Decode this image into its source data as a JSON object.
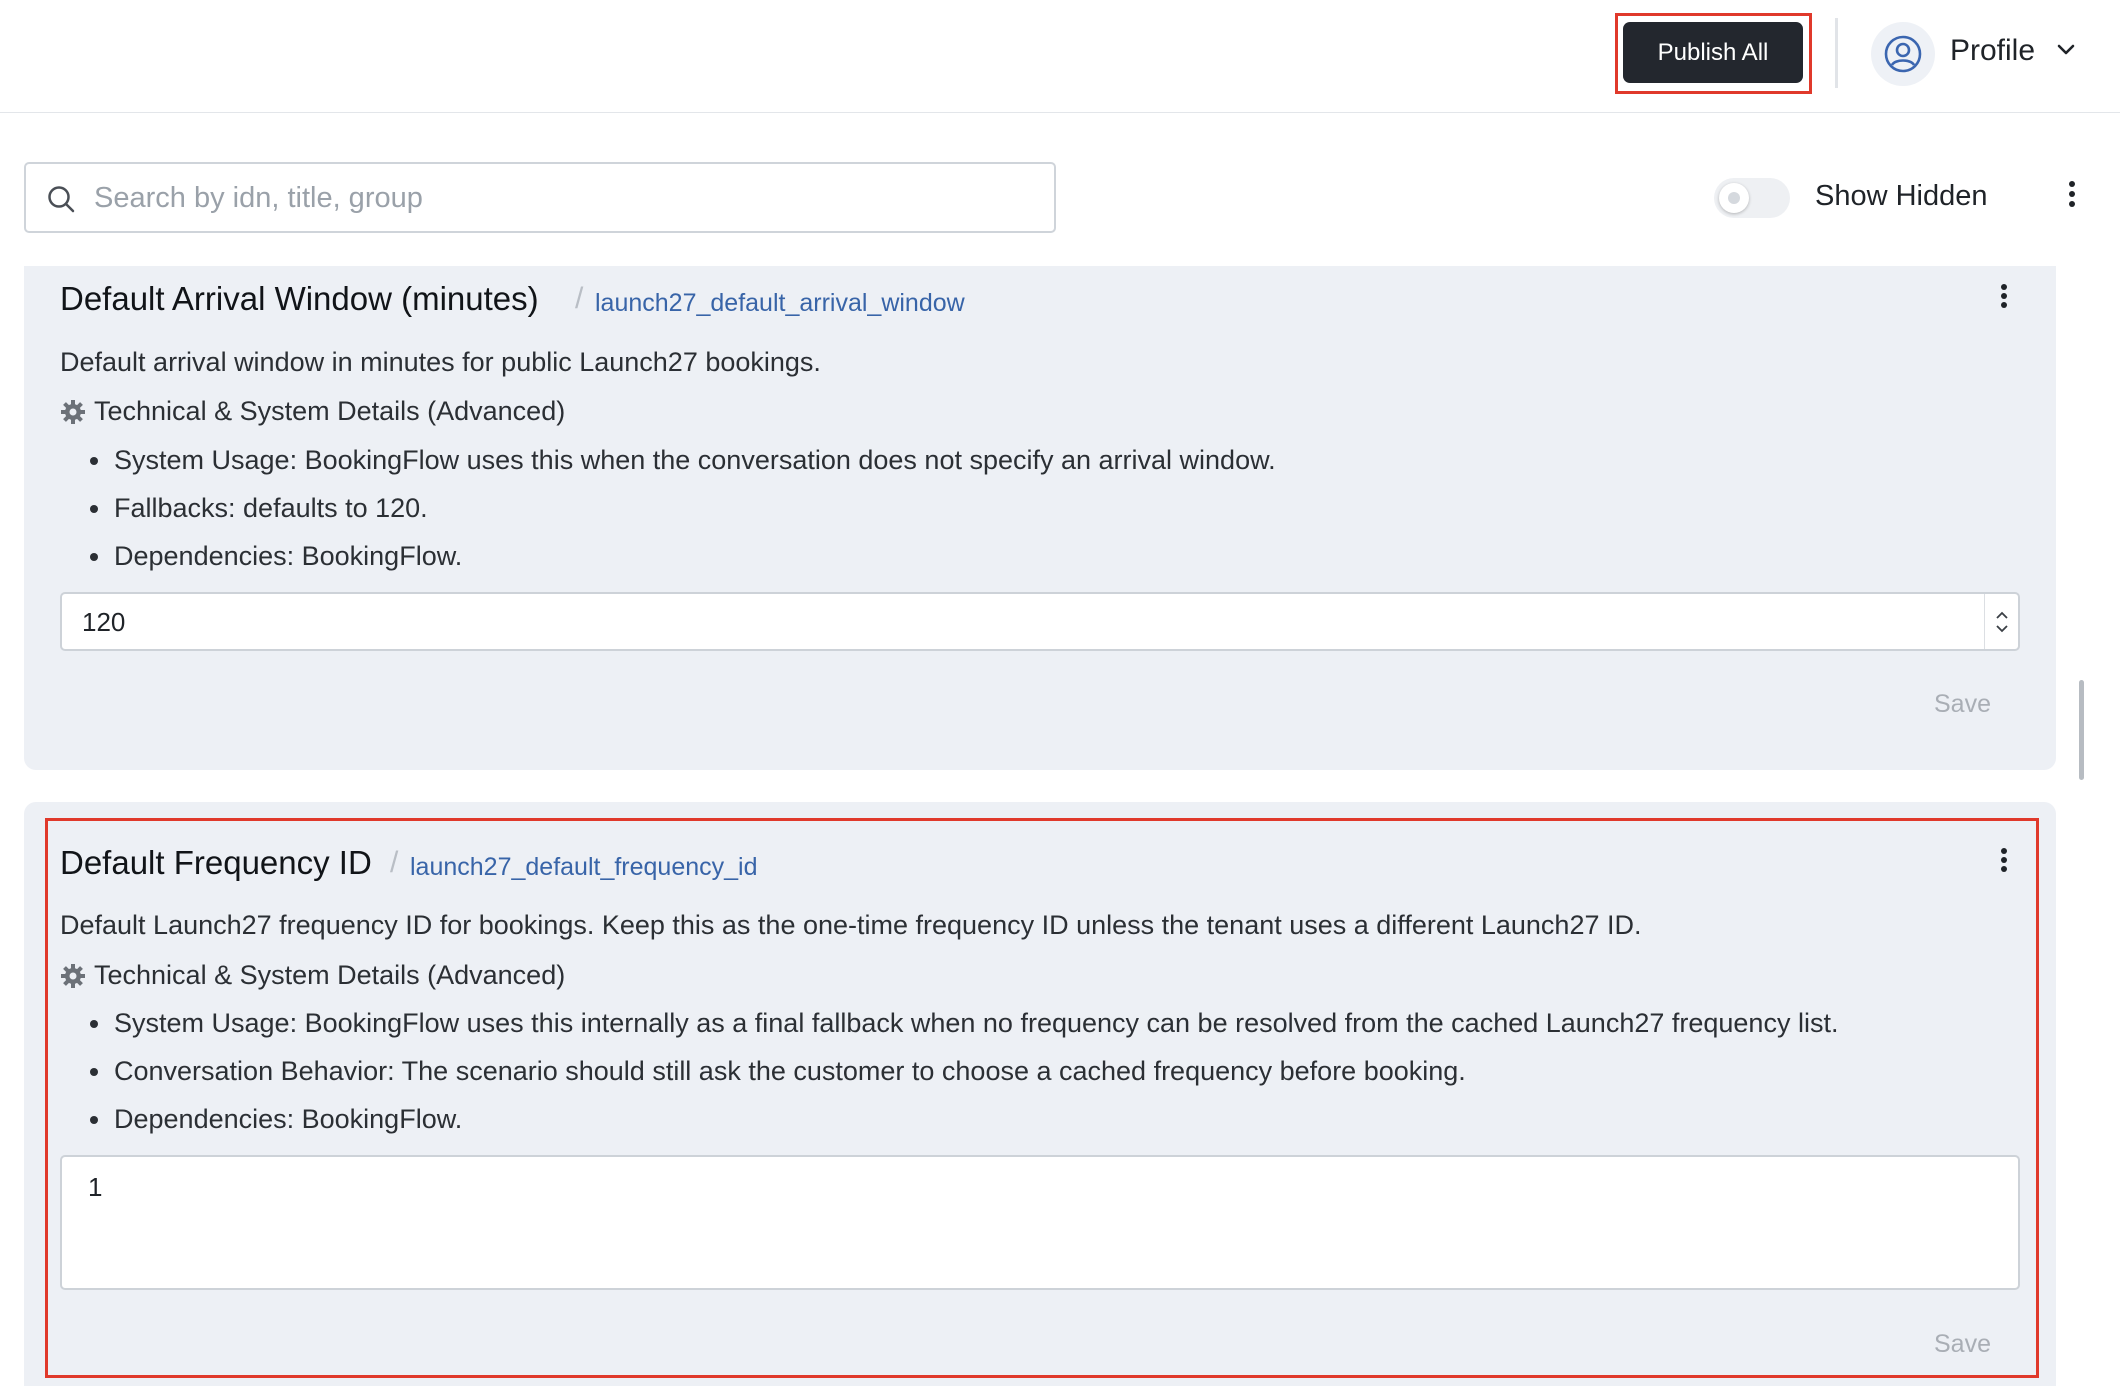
{
  "header": {
    "publish_all_label": "Publish All",
    "profile_label": "Profile"
  },
  "toolbar": {
    "search_placeholder": "Search by idn, title, group",
    "search_value": "",
    "show_hidden_label": "Show Hidden",
    "show_hidden_enabled": false
  },
  "settings": [
    {
      "title": "Default Arrival Window (minutes)",
      "idn": "launch27_default_arrival_window",
      "description": "Default arrival window in minutes for public Launch27 bookings.",
      "technical_label": "Technical & System Details (Advanced)",
      "details": [
        "System Usage: BookingFlow uses this when the conversation does not specify an arrival window.",
        "Fallbacks: defaults to 120.",
        "Dependencies: BookingFlow."
      ],
      "value": "120",
      "save_label": "Save"
    },
    {
      "title": "Default Frequency ID",
      "idn": "launch27_default_frequency_id",
      "description": "Default Launch27 frequency ID for bookings. Keep this as the one-time frequency ID unless the tenant uses a different Launch27 ID.",
      "technical_label": "Technical & System Details (Advanced)",
      "details": [
        "System Usage: BookingFlow uses this internally as a final fallback when no frequency can be resolved from the cached Launch27 frequency list.",
        "Conversation Behavior: The scenario should still ask the customer to choose a cached frequency before booking.",
        "Dependencies: BookingFlow."
      ],
      "value": "1",
      "save_label": "Save"
    }
  ],
  "icons": {
    "search": "search-icon",
    "profile": "user-circle-icon",
    "chevron": "chevron-down-icon",
    "more": "more-vertical-icon",
    "gear": "gear-icon"
  },
  "colors": {
    "primary_button": "#23272e",
    "highlight": "#e0392b",
    "card_bg": "#edf0f5",
    "idn_link": "#3864a8"
  }
}
